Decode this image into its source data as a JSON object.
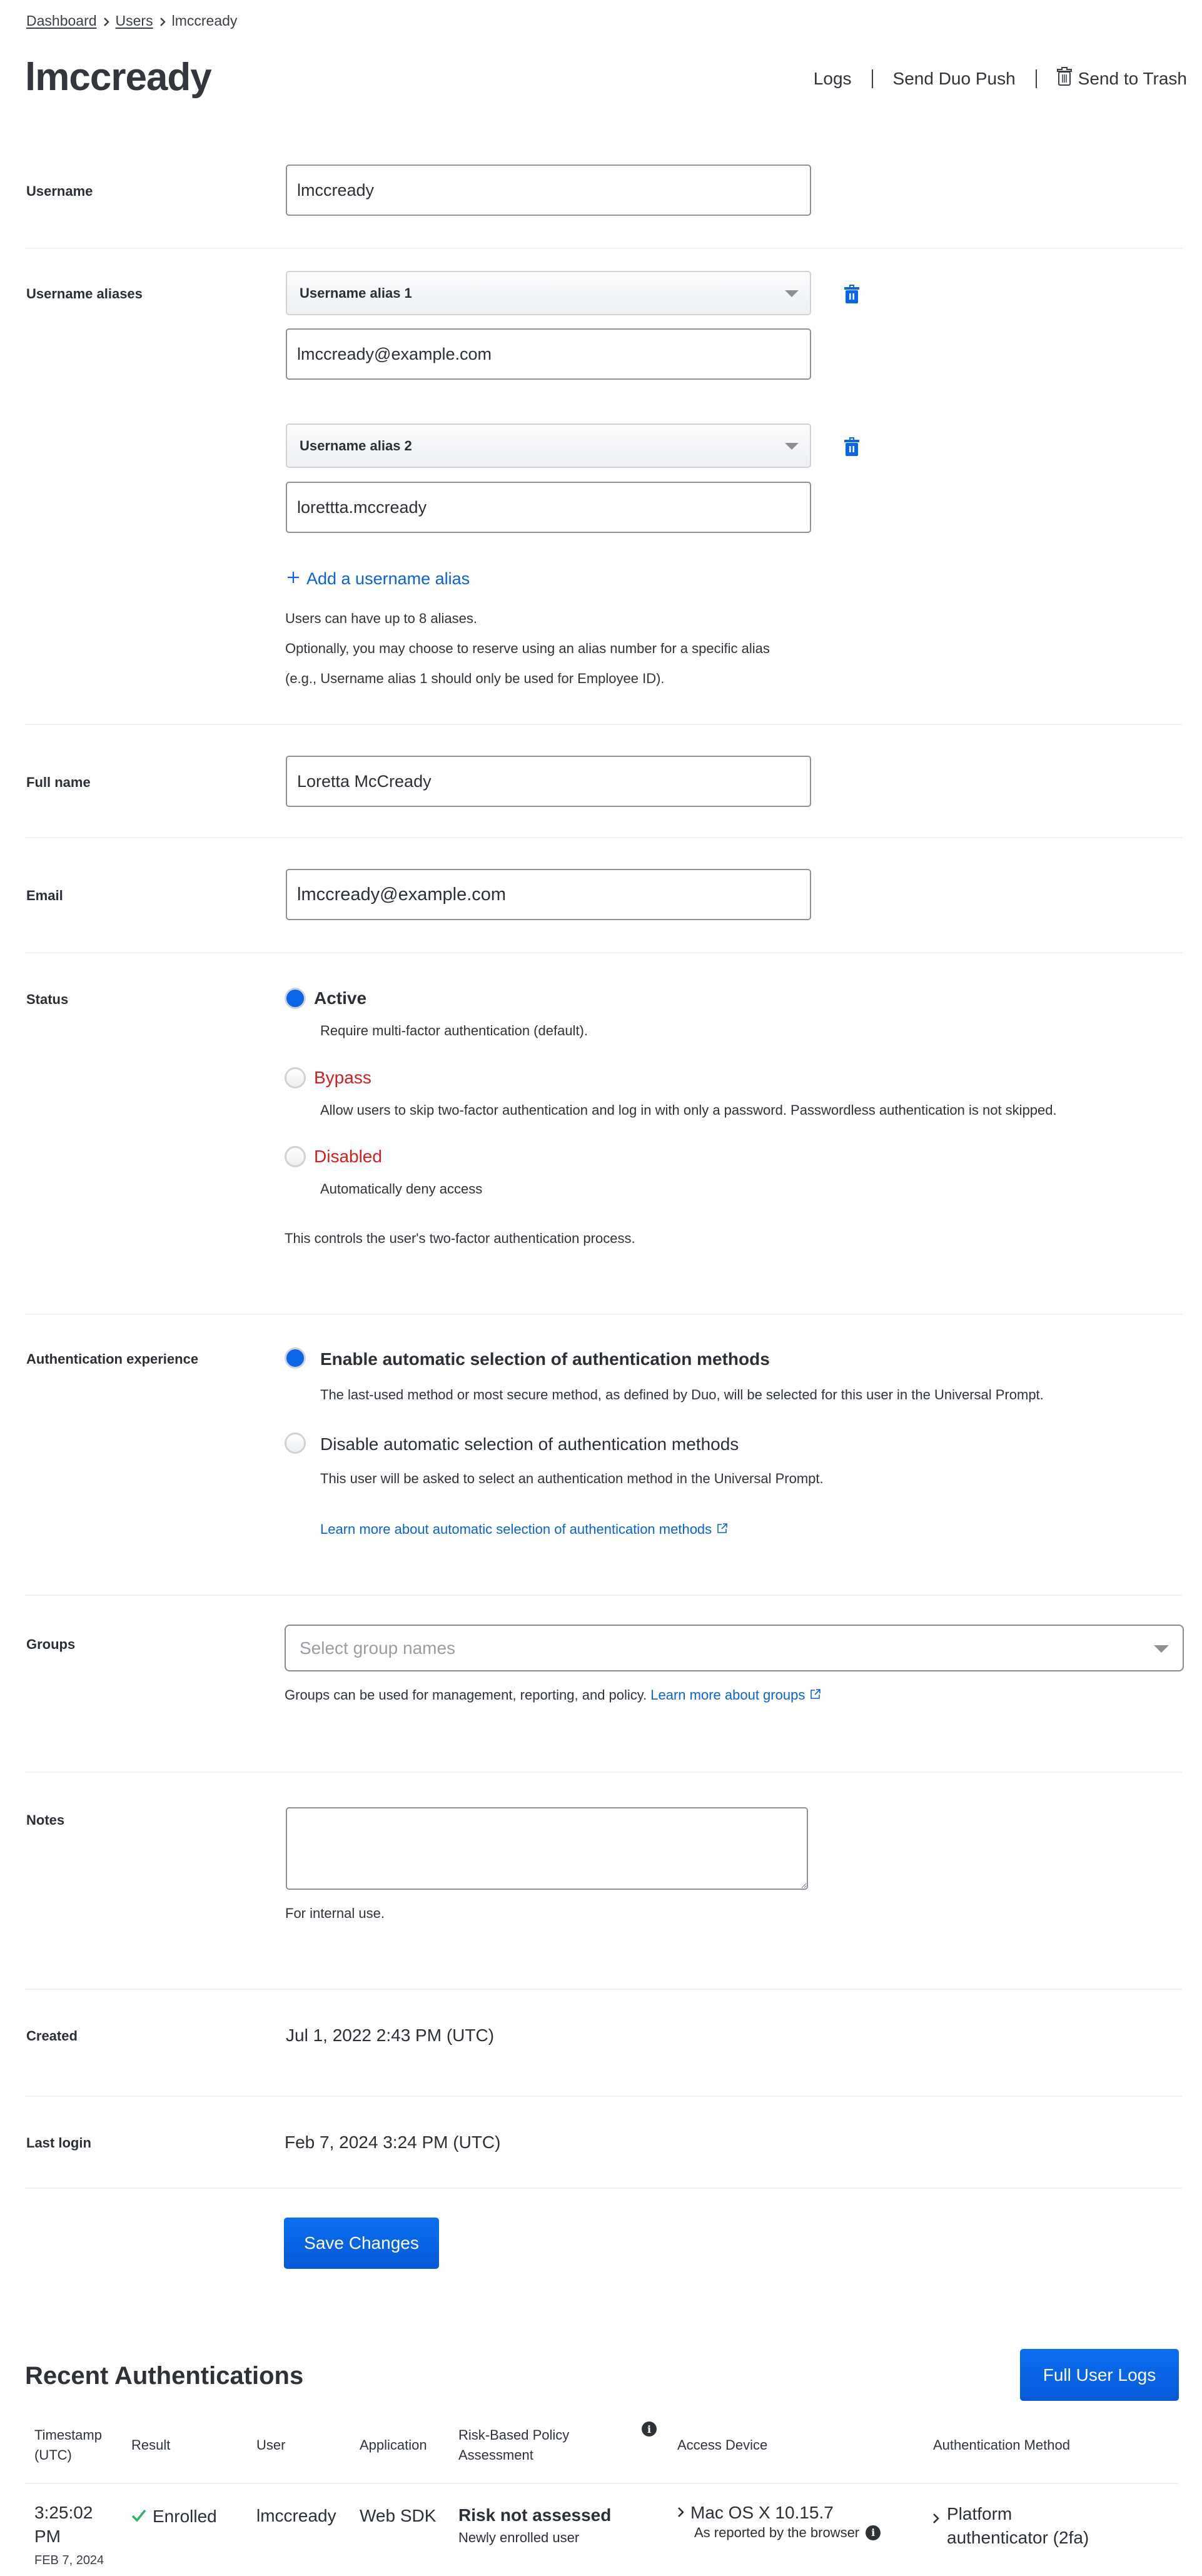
{
  "breadcrumb": {
    "items": [
      {
        "label": "Dashboard"
      },
      {
        "label": "Users"
      }
    ],
    "current": "lmccready"
  },
  "page": {
    "title": "lmccready"
  },
  "actions": {
    "logs": "Logs",
    "send_push": "Send Duo Push",
    "trash": "Send to Trash"
  },
  "form": {
    "username": {
      "label": "Username",
      "value": "lmccready"
    },
    "aliases": {
      "label": "Username aliases",
      "items": [
        {
          "slot": "Username alias 1",
          "value": "lmccready@example.com"
        },
        {
          "slot": "Username alias 2",
          "value": "lorettta.mccready"
        }
      ],
      "add_label": "Add a username alias",
      "help_1": "Users can have up to 8 aliases.",
      "help_2": "Optionally, you may choose to reserve using an alias number for a specific alias",
      "help_3": "(e.g., Username alias 1 should only be used for Employee ID)."
    },
    "full_name": {
      "label": "Full name",
      "value": "Loretta McCready"
    },
    "email": {
      "label": "Email",
      "value": "lmccready@example.com"
    },
    "status": {
      "label": "Status",
      "options": [
        {
          "label": "Active",
          "desc": "Require multi-factor authentication (default).",
          "checked": true
        },
        {
          "label": "Bypass",
          "desc": "Allow users to skip two-factor authentication and log in with only a password. Passwordless authentication is not skipped.",
          "checked": false
        },
        {
          "label": "Disabled",
          "desc": "Automatically deny access",
          "checked": false
        }
      ],
      "help": "This controls the user's two-factor authentication process."
    },
    "auth_experience": {
      "label": "Authentication experience",
      "options": [
        {
          "label": "Enable automatic selection of authentication methods",
          "desc": "The last-used method or most secure method, as defined by Duo, will be selected for this user in the Universal Prompt.",
          "checked": true
        },
        {
          "label": "Disable automatic selection of authentication methods",
          "desc": "This user will be asked to select an authentication method in the Universal Prompt.",
          "checked": false
        }
      ],
      "learn_more": "Learn more about automatic selection of authentication methods"
    },
    "groups": {
      "label": "Groups",
      "placeholder": "Select group names",
      "help": "Groups can be used for management, reporting, and policy.",
      "learn_more": "Learn more about groups"
    },
    "notes": {
      "label": "Notes",
      "value": "",
      "help": "For internal use."
    },
    "created": {
      "label": "Created",
      "value": "Jul 1, 2022 2:43 PM (UTC)"
    },
    "last_login": {
      "label": "Last login",
      "value": "Feb 7, 2024 3:24 PM (UTC)"
    },
    "save_label": "Save Changes"
  },
  "recent_auth": {
    "title": "Recent Authentications",
    "full_logs_label": "Full User Logs",
    "columns": {
      "timestamp": "Timestamp (UTC)",
      "result": "Result",
      "user": "User",
      "application": "Application",
      "risk": "Risk-Based Policy Assessment",
      "access_device": "Access Device",
      "auth_method": "Authentication Method"
    },
    "rows": [
      {
        "time": "3:25:02 PM",
        "date": "FEB 7, 2024",
        "result": "Enrolled",
        "user": "lmccready",
        "application": "Web SDK",
        "risk": "Risk not assessed",
        "risk_detail": "Newly enrolled user",
        "device": "Mac OS X 10.15.7",
        "device_note": "As reported by the browser",
        "method": "Platform authenticator (2fa)"
      }
    ]
  },
  "colors": {
    "accent": "#0a66e6",
    "link": "#0a62d8",
    "danger": "#d21f1f",
    "success": "#2fb36b"
  }
}
